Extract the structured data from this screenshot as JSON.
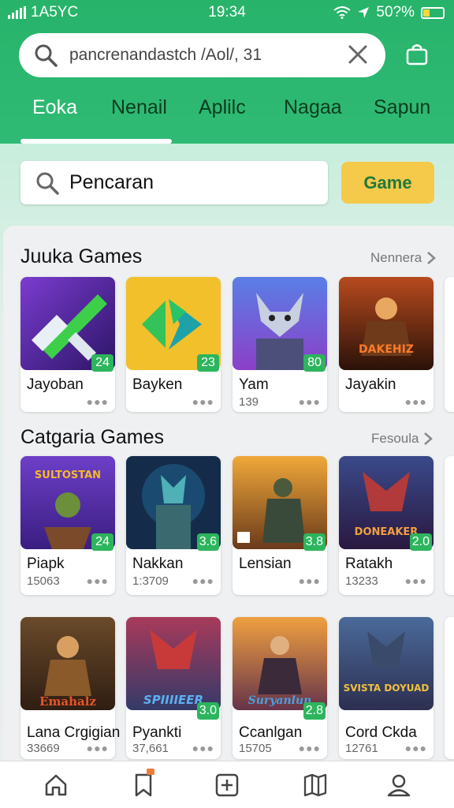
{
  "status": {
    "carrier": "1A5YC",
    "time": "19:34",
    "battery": "50?%"
  },
  "top_search": {
    "value": "pancrenandastch /Aol/, 31"
  },
  "tabs": [
    "Eoka",
    "Nenail",
    "Aplilc",
    "Nagaa",
    "Sapun"
  ],
  "search": {
    "placeholder": "Pencaran",
    "button": "Game"
  },
  "section1": {
    "title": "Juuka Games",
    "link": "Nennera",
    "cards": [
      {
        "name": "Jayoban",
        "sub": "",
        "badge": "24"
      },
      {
        "name": "Bayken",
        "sub": "",
        "badge": "23"
      },
      {
        "name": "Yam",
        "sub": "139",
        "badge": "80"
      },
      {
        "name": "Jayakin",
        "sub": "",
        "badge": ""
      }
    ]
  },
  "section2": {
    "title": "Catgaria Games",
    "link": "Fesoula",
    "cards": [
      {
        "name": "Piapk",
        "sub": "15063",
        "badge": "24"
      },
      {
        "name": "Nakkan",
        "sub": "1:3709",
        "badge": "3.6"
      },
      {
        "name": "Lensian",
        "sub": "",
        "badge": "3.8"
      },
      {
        "name": "Ratakh",
        "sub": "13233",
        "badge": "2.0"
      }
    ]
  },
  "section3": {
    "cards": [
      {
        "name": "Lana Crgigian",
        "sub": "33669",
        "badge": ""
      },
      {
        "name": "Pyankti",
        "sub": "37,661",
        "badge": "3.0"
      },
      {
        "name": "Ccanlgan",
        "sub": "15705",
        "badge": "2.8"
      },
      {
        "name": "Cord Ckda",
        "sub": "12761",
        "badge": ""
      }
    ]
  },
  "art_labels": {
    "yam": "",
    "jayakin": "DAKEHIZ",
    "piapk": "SULTOSTAN",
    "ratakh": "DONEAKER",
    "lana": "Emahalz",
    "pyankti": "SPIIIIEER",
    "ccanlgan": "Suryanlun",
    "cord": "SVISTA DOYUAD"
  },
  "colors": {
    "brand": "#27b36a",
    "accent": "#f5c94a",
    "badge": "#2db55d"
  },
  "icons": [
    "signal-icon",
    "wifi-icon",
    "location-icon",
    "battery-icon",
    "search-icon",
    "close-icon",
    "shopping-bag-icon",
    "chevron-right-icon",
    "home-icon",
    "bookmark-icon",
    "plus-square-icon",
    "book-icon",
    "user-icon"
  ]
}
